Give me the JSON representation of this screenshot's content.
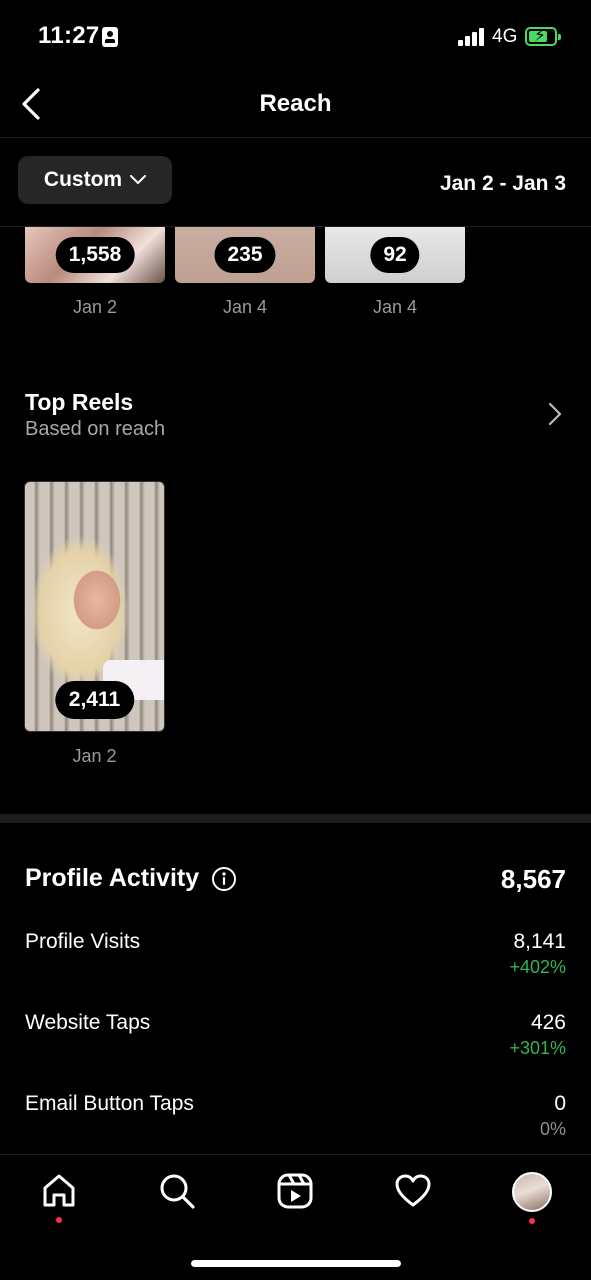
{
  "status_bar": {
    "time": "11:27",
    "network": "4G"
  },
  "header": {
    "title": "Reach"
  },
  "filter": {
    "range_button": "Custom",
    "date_range": "Jan 2 - Jan 3"
  },
  "top_posts": [
    {
      "value": "1,558",
      "date": "Jan 2"
    },
    {
      "value": "235",
      "date": "Jan 4"
    },
    {
      "value": "92",
      "date": "Jan 4"
    }
  ],
  "top_reels": {
    "title": "Top Reels",
    "subtitle": "Based on reach",
    "items": [
      {
        "value": "2,411",
        "date": "Jan 2"
      }
    ]
  },
  "profile_activity": {
    "title": "Profile Activity",
    "total": "8,567",
    "rows": [
      {
        "label": "Profile Visits",
        "value": "8,141",
        "change": "+402%"
      },
      {
        "label": "Website Taps",
        "value": "426",
        "change": "+301%"
      },
      {
        "label": "Email Button Taps",
        "value": "0",
        "change": "0%"
      }
    ]
  },
  "colors": {
    "positive": "#2fb552",
    "notification_dot": "#ff3040",
    "battery": "#4cd964"
  },
  "tabbar": [
    "home-icon",
    "search-icon",
    "reels-icon",
    "heart-icon",
    "profile-avatar"
  ]
}
